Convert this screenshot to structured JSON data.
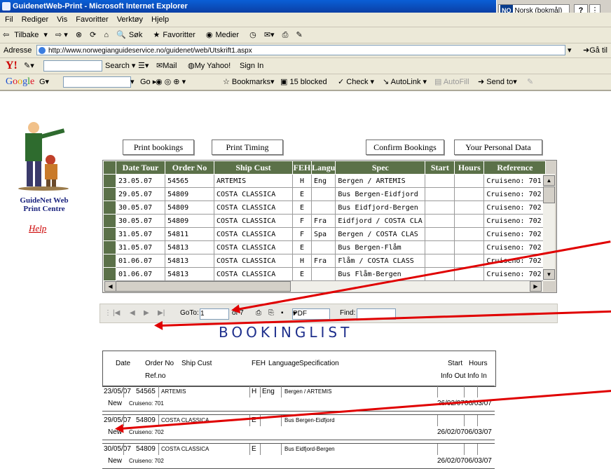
{
  "window": {
    "title": "GuidenetWeb-Print - Microsoft Internet Explorer",
    "lang_label": "NO",
    "lang_name": "Norsk (bokmål)"
  },
  "menu": [
    "Fil",
    "Rediger",
    "Vis",
    "Favoritter",
    "Verktøy",
    "Hjelp"
  ],
  "std_toolbar": {
    "back": "Tilbake",
    "search": "Søk",
    "favorites": "Favoritter",
    "media": "Medier"
  },
  "address": {
    "label": "Adresse",
    "url": "http://www.norwegianguideservice.no/guidenet/web/Utskrift1.aspx",
    "go": "Gå til"
  },
  "yahoo": {
    "search": "Search",
    "mail": "Mail",
    "my_yahoo": "My Yahoo!",
    "sign_in": "Sign In"
  },
  "google": {
    "go": "Go",
    "bookmarks": "Bookmarks",
    "blocked": "15 blocked",
    "check": "Check",
    "autolink": "AutoLink",
    "autofill": "AutoFill",
    "send_to": "Send to"
  },
  "sidebar": {
    "title": "GuideNet Web Print Centre",
    "help": "Help"
  },
  "buttons": {
    "print_bookings": "Print bookings",
    "print_timing": "Print Timing",
    "confirm": "Confirm Bookings",
    "personal": "Your Personal Data"
  },
  "grid": {
    "headers": [
      "Date Tour",
      "Order No",
      "Ship Cust",
      "FEH",
      "Langu",
      "Spec",
      "Start",
      "Hours",
      "Reference"
    ],
    "rows": [
      [
        "23.05.07",
        "54565",
        "ARTEMIS",
        "H",
        "Eng",
        "Bergen / ARTEMIS",
        "",
        "",
        "Cruiseno: 701"
      ],
      [
        "29.05.07",
        "54809",
        "COSTA CLASSICA",
        "E",
        "",
        "Bus Bergen-Eidfjord",
        "",
        "",
        "Cruiseno: 702"
      ],
      [
        "30.05.07",
        "54809",
        "COSTA CLASSICA",
        "E",
        "",
        "Bus Eidfjord-Bergen",
        "",
        "",
        "Cruiseno: 702"
      ],
      [
        "30.05.07",
        "54809",
        "COSTA CLASSICA",
        "F",
        "Fra",
        "Eidfjord / COSTA CLA",
        "",
        "",
        "Cruiseno: 702"
      ],
      [
        "31.05.07",
        "54811",
        "COSTA CLASSICA",
        "F",
        "Spa",
        "Bergen / COSTA CLAS",
        "",
        "",
        "Cruiseno: 702"
      ],
      [
        "31.05.07",
        "54813",
        "COSTA CLASSICA",
        "E",
        "",
        "Bus Bergen-Flåm",
        "",
        "",
        "Cruiseno: 702"
      ],
      [
        "01.06.07",
        "54813",
        "COSTA CLASSICA",
        "H",
        "Fra",
        "Flåm / COSTA CLASS",
        "",
        "",
        "Cruiseno: 702"
      ],
      [
        "01.06.07",
        "54813",
        "COSTA CLASSICA",
        "E",
        "",
        "Bus Flåm-Bergen",
        "",
        "",
        "Cruiseno: 702"
      ]
    ]
  },
  "report_toolbar": {
    "goto_label": "GoTo:",
    "page": "1",
    "of": "of 7",
    "format": "PDF",
    "find": "Find:"
  },
  "report": {
    "title": "BOOKINGLIST",
    "headers": {
      "date": "Date",
      "order": "Order No",
      "refno": "Ref.no",
      "ship": "Ship Cust",
      "feh": "FEH",
      "lang": "Language",
      "spec": "Specification",
      "start": "Start",
      "info_out": "Info Out",
      "hours": "Hours",
      "info_in": "Info In"
    },
    "rows": [
      {
        "date": "23/05/07",
        "order": "54565",
        "ship": "ARTEMIS",
        "feh": "H",
        "lang": "Eng",
        "spec": "Bergen / ARTEMIS",
        "status": "New",
        "ref": "Cruiseno: 701",
        "info": "26/02/07|06/03/07"
      },
      {
        "date": "29/05/07",
        "order": "54809",
        "ship": "COSTA CLASSICA",
        "feh": "E",
        "lang": "",
        "spec": "Bus Bergen-Eidfjord",
        "status": "New",
        "ref": "Cruiseno: 702",
        "info": "26/02/07|06/03/07"
      },
      {
        "date": "30/05/07",
        "order": "54809",
        "ship": "COSTA CLASSICA",
        "feh": "E",
        "lang": "",
        "spec": "Bus Eidfjord-Bergen",
        "status": "New",
        "ref": "Cruiseno: 702",
        "info": "26/02/07|06/03/07"
      }
    ]
  }
}
